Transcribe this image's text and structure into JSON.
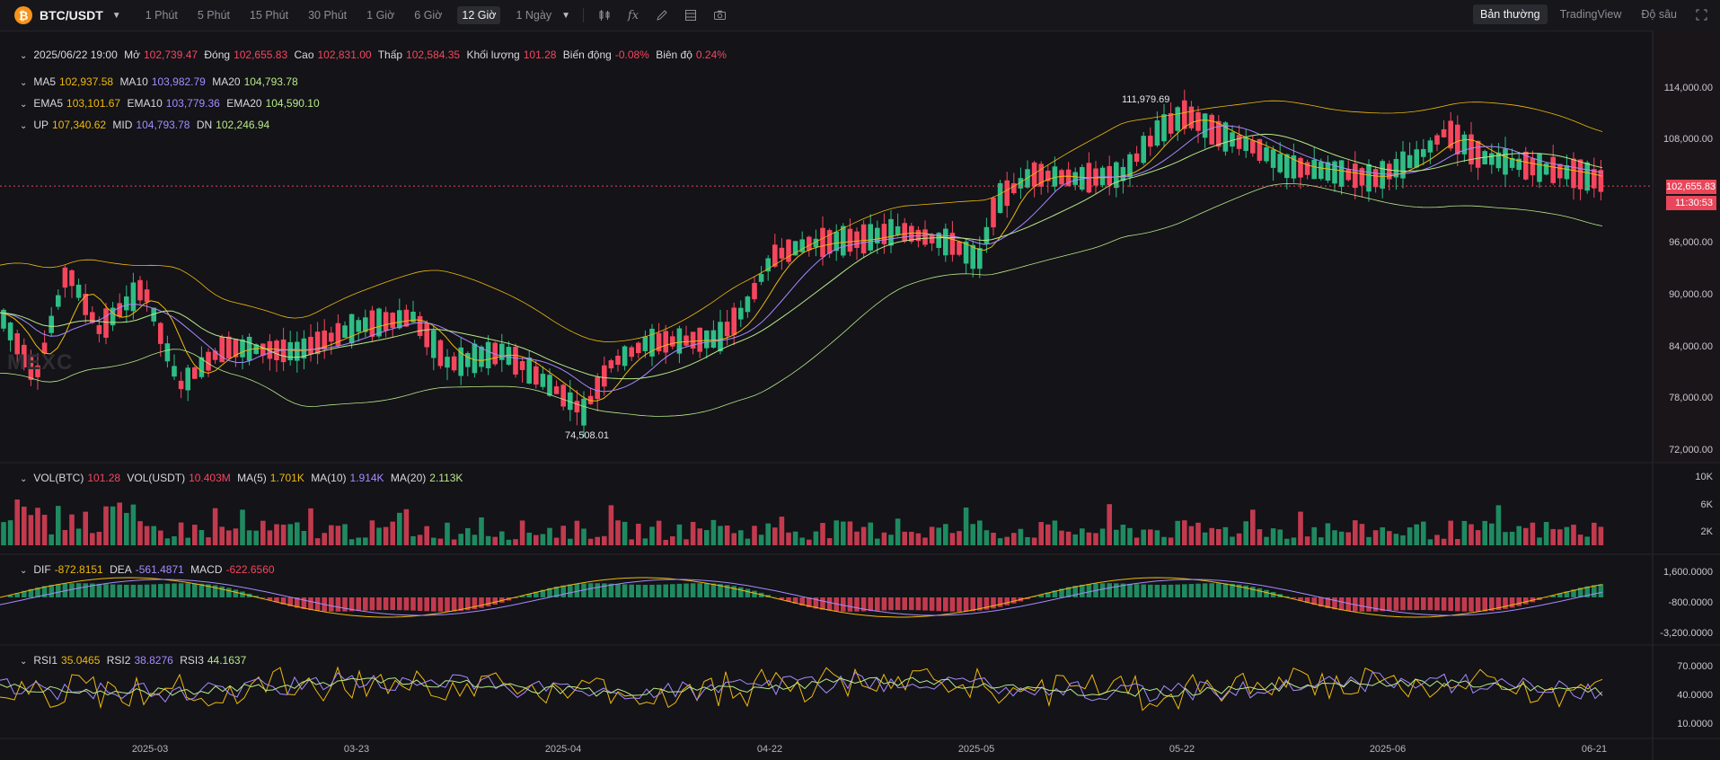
{
  "header": {
    "pair": "BTC/USDT",
    "timeframes": [
      "1 Phút",
      "5 Phút",
      "15 Phút",
      "30 Phút",
      "1 Giờ",
      "6 Giờ",
      "12 Giờ",
      "1 Ngày"
    ],
    "active_timeframe": "12 Giờ",
    "views": [
      "Bản thường",
      "TradingView",
      "Độ sâu"
    ],
    "active_view": "Bản thường"
  },
  "ohlc": {
    "date": "2025/06/22 19:00",
    "open_label": "Mở",
    "open": "102,739.47",
    "close_label": "Đóng",
    "close": "102,655.83",
    "high_label": "Cao",
    "high": "102,831.00",
    "low_label": "Thấp",
    "low": "102,584.35",
    "vol_label": "Khối lượng",
    "vol": "101.28",
    "chg_label": "Biến động",
    "chg": "-0.08%",
    "amp_label": "Biên độ",
    "amp": "0.24%"
  },
  "ma": {
    "ma5_label": "MA5",
    "ma5": "102,937.58",
    "ma10_label": "MA10",
    "ma10": "103,982.79",
    "ma20_label": "MA20",
    "ma20": "104,793.78"
  },
  "ema": {
    "ema5_label": "EMA5",
    "ema5": "103,101.67",
    "ema10_label": "EMA10",
    "ema10": "103,779.36",
    "ema20_label": "EMA20",
    "ema20": "104,590.10"
  },
  "boll": {
    "up_label": "UP",
    "up": "107,340.62",
    "mid_label": "MID",
    "mid": "104,793.78",
    "dn_label": "DN",
    "dn": "102,246.94"
  },
  "volume": {
    "btc_label": "VOL(BTC)",
    "btc": "101.28",
    "usdt_label": "VOL(USDT)",
    "usdt": "10.403M",
    "ma5_label": "MA(5)",
    "ma5": "1.701K",
    "ma10_label": "MA(10)",
    "ma10": "1.914K",
    "ma20_label": "MA(20)",
    "ma20": "2.113K"
  },
  "macd": {
    "dif_label": "DIF",
    "dif": "-872.8151",
    "dea_label": "DEA",
    "dea": "-561.4871",
    "macd_label": "MACD",
    "macd": "-622.6560"
  },
  "rsi": {
    "rsi1_label": "RSI1",
    "rsi1": "35.0465",
    "rsi2_label": "RSI2",
    "rsi2": "38.8276",
    "rsi3_label": "RSI3",
    "rsi3": "44.1637"
  },
  "price_axis": [
    "114,000.00",
    "108,000.00",
    "96,000.00",
    "90,000.00",
    "84,000.00",
    "78,000.00",
    "72,000.00"
  ],
  "vol_axis": [
    "10K",
    "6K",
    "2K"
  ],
  "macd_axis": [
    "1,600.0000",
    "-800.0000",
    "-3,200.0000"
  ],
  "rsi_axis": [
    "70.0000",
    "40.0000",
    "10.0000"
  ],
  "x_axis": [
    "2025-03",
    "03-23",
    "2025-04",
    "04-22",
    "2025-05",
    "05-22",
    "2025-06",
    "06-21"
  ],
  "last_price": "102,655.83",
  "countdown": "11:30:53",
  "high_marker": "111,979.69",
  "low_marker": "74,508.01",
  "watermark": "MEXC",
  "colors": {
    "up": "#2ebd85",
    "down": "#f6465d",
    "ma5": "#f0b90b",
    "ma10": "#a68bff",
    "ma20": "#b8e986",
    "accent": "#e8465a"
  }
}
